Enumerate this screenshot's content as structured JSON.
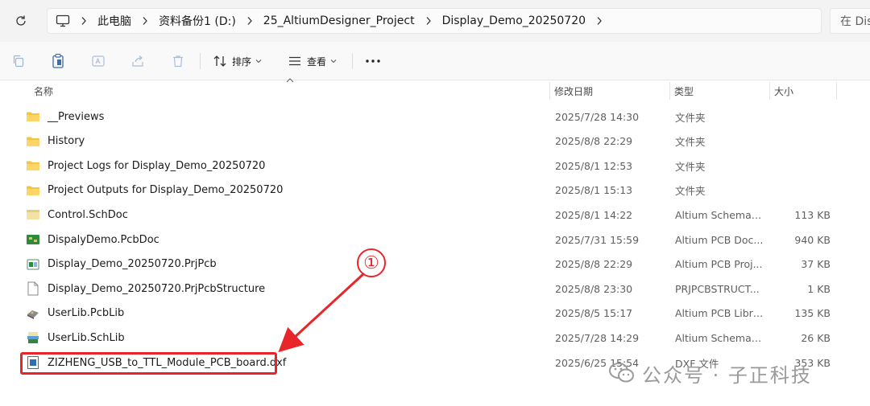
{
  "breadcrumb": {
    "segments": [
      "此电脑",
      "资料备份1 (D:)",
      "25_AltiumDesigner_Project",
      "Display_Demo_20250720"
    ],
    "search_placeholder": "在 Dis"
  },
  "toolbar": {
    "sort_label": "排序",
    "view_label": "查看"
  },
  "columns": {
    "name": "名称",
    "date": "修改日期",
    "type": "类型",
    "size": "大小"
  },
  "files": [
    {
      "name": "__Previews",
      "date": "2025/7/28 14:30",
      "type": "文件夹",
      "size": "",
      "icon": "folder-icon"
    },
    {
      "name": "History",
      "date": "2025/8/8 22:29",
      "type": "文件夹",
      "size": "",
      "icon": "folder-icon"
    },
    {
      "name": "Project Logs for Display_Demo_20250720",
      "date": "2025/8/1 12:53",
      "type": "文件夹",
      "size": "",
      "icon": "folder-icon"
    },
    {
      "name": "Project Outputs for Display_Demo_20250720",
      "date": "2025/8/1 15:13",
      "type": "文件夹",
      "size": "",
      "icon": "folder-icon"
    },
    {
      "name": "Control.SchDoc",
      "date": "2025/8/1 14:22",
      "type": "Altium Schemati...",
      "size": "113 KB",
      "icon": "schdoc-icon"
    },
    {
      "name": "DispalyDemo.PcbDoc",
      "date": "2025/7/31 15:59",
      "type": "Altium PCB Doc...",
      "size": "940 KB",
      "icon": "pcbdoc-icon"
    },
    {
      "name": "Display_Demo_20250720.PrjPcb",
      "date": "2025/8/8 22:29",
      "type": "Altium PCB Proj...",
      "size": "37 KB",
      "icon": "prjpcb-icon"
    },
    {
      "name": "Display_Demo_20250720.PrjPcbStructure",
      "date": "2025/8/8 23:30",
      "type": "PRJPCBSTRUCT...",
      "size": "1 KB",
      "icon": "blank-file-icon"
    },
    {
      "name": "UserLib.PcbLib",
      "date": "2025/8/5 15:17",
      "type": "Altium PCB Libra...",
      "size": "135 KB",
      "icon": "pcblib-icon"
    },
    {
      "name": "UserLib.SchLib",
      "date": "2025/7/28 14:29",
      "type": "Altium Schemati...",
      "size": "26 KB",
      "icon": "schlib-icon"
    },
    {
      "name": "ZIZHENG_USB_to_TTL_Module_PCB_board.dxf",
      "date": "2025/6/25 15:54",
      "type": "DXF 文件",
      "size": "353 KB",
      "icon": "dxf-icon"
    }
  ],
  "annotation": {
    "number": "①"
  },
  "watermark": {
    "text": "公众号 · 子正科技"
  },
  "colors": {
    "accent_red": "#e8262a",
    "folder": "#f4c542"
  }
}
